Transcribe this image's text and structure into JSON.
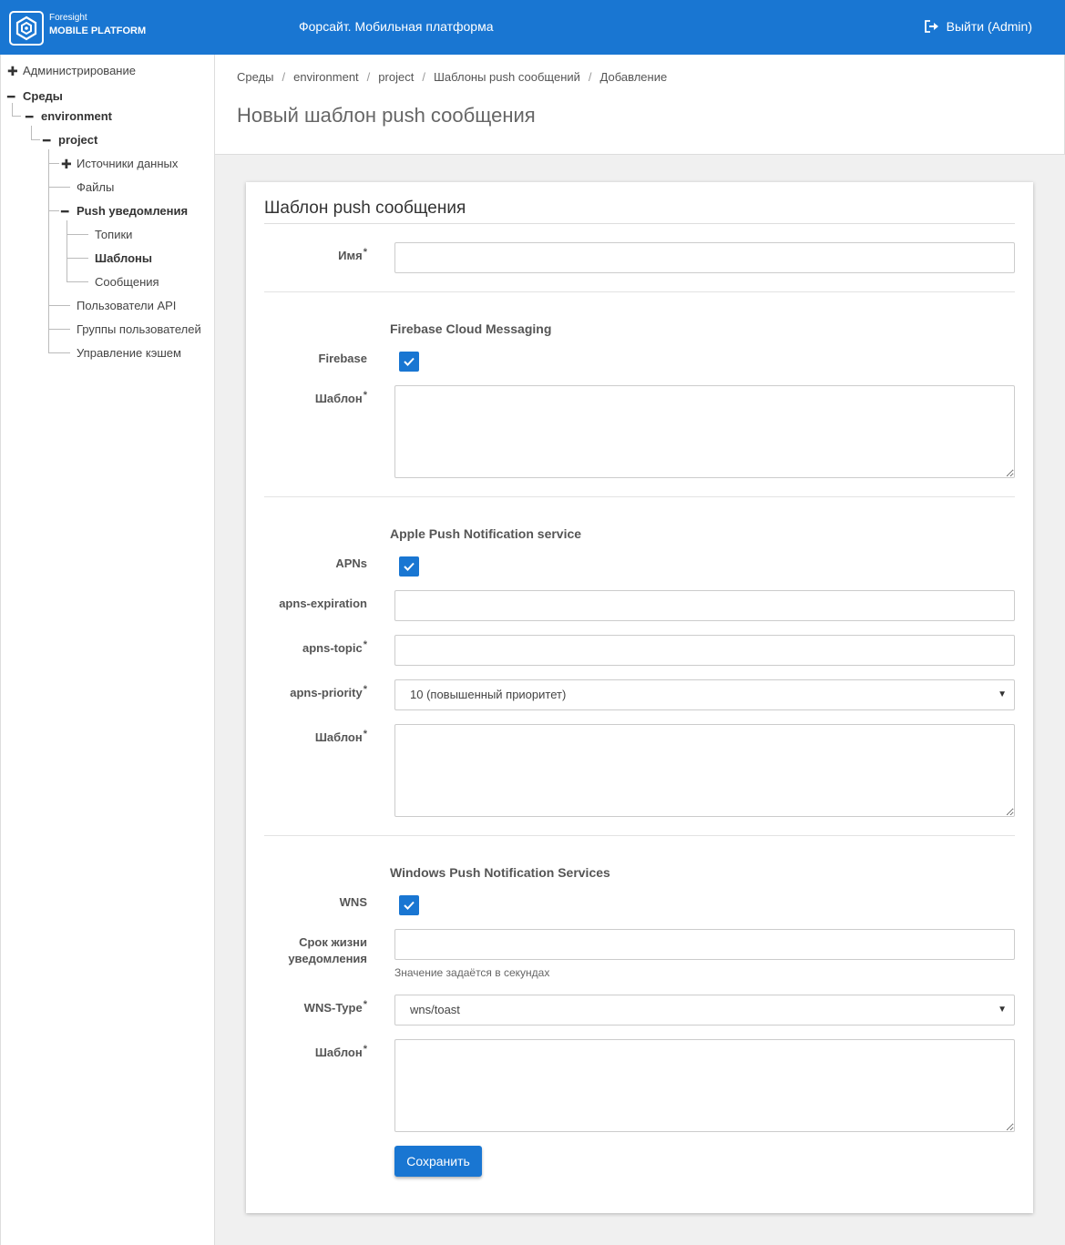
{
  "header": {
    "logo_line1": "Foresight",
    "logo_line2": "MOBILE PLATFORM",
    "title": "Форсайт. Мобильная платформа",
    "logout_label": "Выйти (Admin)"
  },
  "sidebar": {
    "administration": "Администрирование",
    "environments": "Среды",
    "environment": "environment",
    "project": "project",
    "data_sources": "Источники данных",
    "files": "Файлы",
    "push": "Push уведомления",
    "topics": "Топики",
    "templates": "Шаблоны",
    "messages": "Сообщения",
    "api_users": "Пользователи API",
    "user_groups": "Группы пользователей",
    "cache": "Управление кэшем"
  },
  "breadcrumb": [
    "Среды",
    "environment",
    "project",
    "Шаблоны push сообщений",
    "Добавление"
  ],
  "page_title": "Новый шаблон push сообщения",
  "form": {
    "card_title": "Шаблон push сообщения",
    "name_label": "Имя",
    "fcm_title": "Firebase Cloud Messaging",
    "firebase_label": "Firebase",
    "template_label": "Шаблон",
    "apns_title": "Apple Push Notification service",
    "apns_label": "APNs",
    "apns_expiration_label": "apns-expiration",
    "apns_topic_label": "apns-topic",
    "apns_priority_label": "apns-priority",
    "apns_priority_value": "10 (повышенный приоритет)",
    "wns_title": "Windows Push Notification Services",
    "wns_label": "WNS",
    "ttl_label_1": "Срок жизни",
    "ttl_label_2": "уведомления",
    "ttl_hint": "Значение задаётся в секундах",
    "wns_type_label": "WNS-Type",
    "wns_type_value": "wns/toast",
    "required_mark": "*",
    "save_label": "Сохранить",
    "firebase_checked": true,
    "apns_checked": true,
    "wns_checked": true
  },
  "colors": {
    "brand": "#1976d2"
  }
}
